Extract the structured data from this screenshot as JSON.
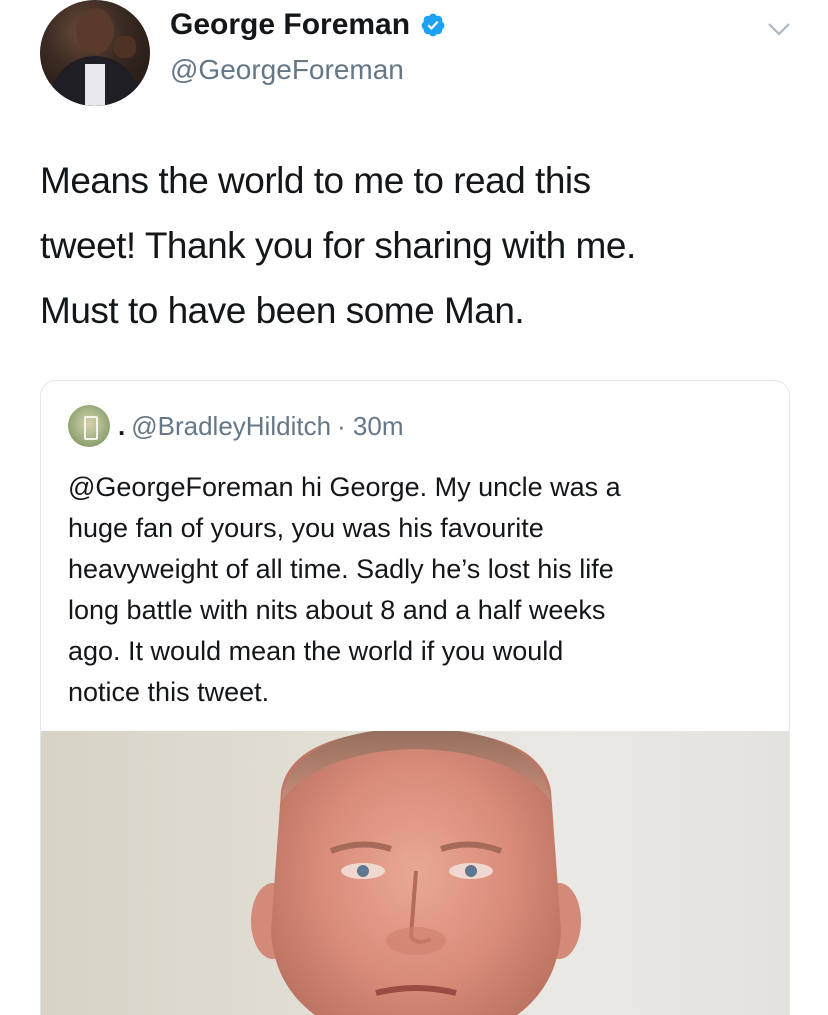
{
  "tweet": {
    "author_name": "George Foreman",
    "author_handle": "@GeorgeForeman",
    "text_lines": [
      "Means the world to me to read this",
      "tweet! Thank you for sharing with me.",
      "Must to have been some Man."
    ]
  },
  "quoted_tweet": {
    "separator": ".",
    "handle": "@BradleyHilditch",
    "time": "· 30m",
    "text_lines": [
      "@GeorgeForeman hi George. My uncle was a",
      "huge fan of yours, you was his favourite",
      "heavyweight of all time. Sadly he’s lost his life",
      "long battle with nits about 8 and a half weeks",
      "ago. It would mean the world if you would",
      "notice this tweet."
    ]
  },
  "colors": {
    "verified_blue": "#1da1f2",
    "secondary_text": "#657786",
    "card_border": "#e1e8ed"
  },
  "icons": {
    "verified": "verified-badge-icon",
    "more": "chevron-down-icon"
  }
}
